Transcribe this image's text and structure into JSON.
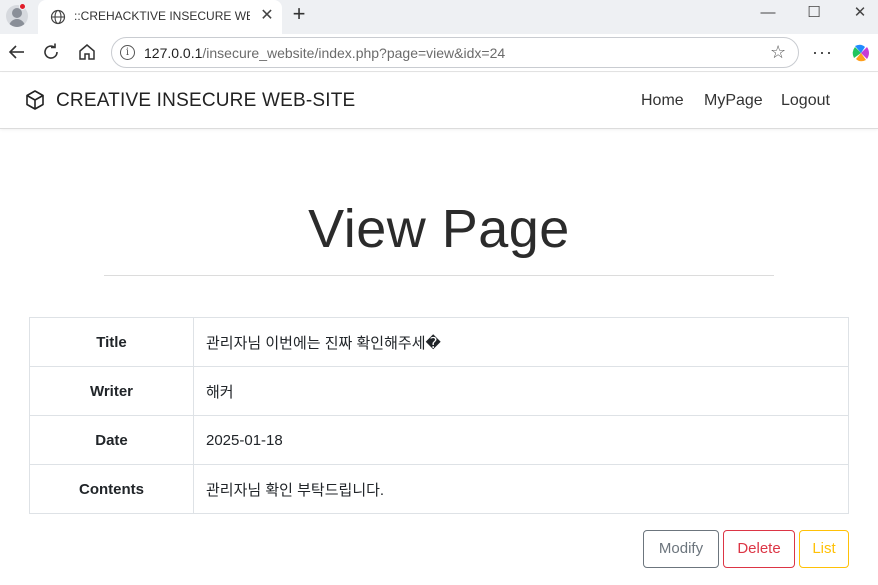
{
  "browser": {
    "tab_title": "::CREHACKTIVE INSECURE WEB-SITE::",
    "url_host": "127.0.0.1",
    "url_path": "/insecure_website/index.php?page=view&idx=24",
    "info_glyph": "i",
    "new_tab_glyph": "+",
    "close_glyph": "✕",
    "minimize_glyph": "—",
    "maximize_glyph": "☐",
    "more_glyph": "···",
    "star_glyph": "☆"
  },
  "navbar": {
    "brand": "CREATIVE INSECURE WEB-SITE",
    "links": [
      "Home",
      "MyPage",
      "Logout"
    ]
  },
  "page": {
    "heading": "View Page"
  },
  "post": {
    "rows": [
      {
        "label": "Title",
        "value": "관리자님 이번에는 진짜 확인해주세�"
      },
      {
        "label": "Writer",
        "value": "해커"
      },
      {
        "label": "Date",
        "value": "2025-01-18"
      },
      {
        "label": "Contents",
        "value": "관리자님 확인 부탁드립니다."
      }
    ]
  },
  "actions": {
    "modify": "Modify",
    "delete": "Delete",
    "list": "List"
  },
  "colors": {
    "modify": "#6c757d",
    "delete": "#dc3545",
    "list": "#ffc107",
    "profile_badge": "#e11d2a"
  }
}
